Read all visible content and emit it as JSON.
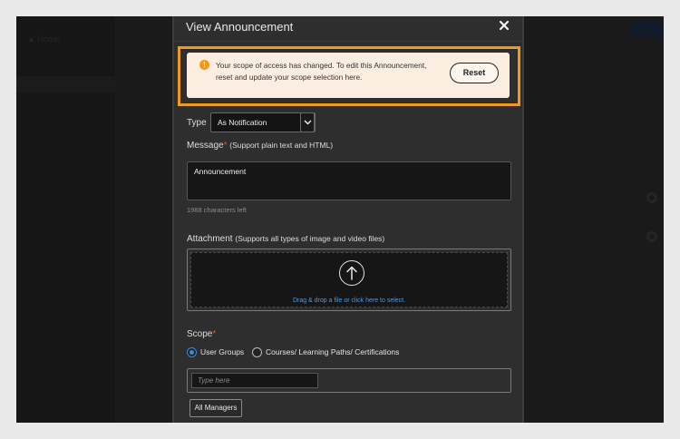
{
  "modal": {
    "title": "View Announcement",
    "close_icon": "close-icon",
    "banner": {
      "icon": "info-icon",
      "icon_glyph": "!",
      "text": "Your scope of access has changed. To edit this Announcement, reset and update your scope selection here.",
      "reset_label": "Reset",
      "accent_color": "#f09a1a"
    },
    "type": {
      "label": "Type",
      "value": "As Notification"
    },
    "message": {
      "label": "Message",
      "required_marker": "*",
      "hint": "(Support plain text and HTML)",
      "value": "Announcement",
      "char_count": "1988 characters left"
    },
    "attachment": {
      "label": "Attachment",
      "hint": "(Supports all types of image and video files)",
      "upload_icon": "upload-arrow-icon",
      "drop_text": "Drag & drop a file or click here to select."
    },
    "scope": {
      "label": "Scope",
      "required_marker": "*",
      "options": [
        {
          "label": "User Groups",
          "selected": true
        },
        {
          "label": "Courses/ Learning Paths/ Certifications",
          "selected": false
        }
      ],
      "input_placeholder": "Type here",
      "chips": [
        "All Managers"
      ]
    }
  }
}
